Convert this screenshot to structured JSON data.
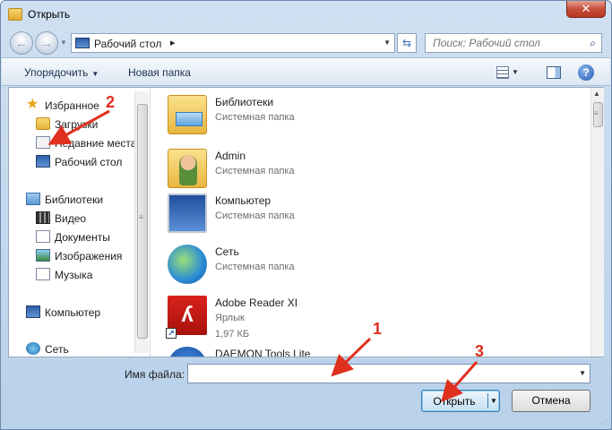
{
  "window": {
    "title": "Открыть",
    "close_label": "✕"
  },
  "address_bar": {
    "path": "Рабочий стол",
    "path_arrow": "▸",
    "search_placeholder": "Поиск: Рабочий стол"
  },
  "toolbar": {
    "organize_label": "Упорядочить",
    "new_folder_label": "Новая папка",
    "help_label": "?"
  },
  "nav_pane": {
    "items": [
      {
        "label": "Избранное",
        "icon": "star-icon"
      },
      {
        "label": "Загрузки",
        "icon": "downloads-folder-icon"
      },
      {
        "label": "Недавние места",
        "icon": "recent-places-icon"
      },
      {
        "label": "Рабочий стол",
        "icon": "desktop-icon"
      },
      {
        "label": "Библиотеки",
        "icon": "libraries-icon"
      },
      {
        "label": "Видео",
        "icon": "video-icon"
      },
      {
        "label": "Документы",
        "icon": "documents-icon"
      },
      {
        "label": "Изображения",
        "icon": "pictures-icon"
      },
      {
        "label": "Музыка",
        "icon": "music-icon"
      },
      {
        "label": "Компьютер",
        "icon": "computer-icon"
      },
      {
        "label": "Сеть",
        "icon": "network-icon"
      }
    ]
  },
  "files": [
    {
      "name": "Библиотеки",
      "type": "Системная папка",
      "icon": "libraries-folder-icon"
    },
    {
      "name": "Admin",
      "type": "Системная папка",
      "icon": "user-folder-icon"
    },
    {
      "name": "Компьютер",
      "type": "Системная папка",
      "icon": "computer-icon"
    },
    {
      "name": "Сеть",
      "type": "Системная папка",
      "icon": "network-icon"
    },
    {
      "name": "Adobe Reader XI",
      "type": "Ярлык",
      "size": "1,97 КБ",
      "icon": "pdf-shortcut-icon"
    },
    {
      "name": "DAEMON Tools Lite",
      "type": "",
      "icon": "daemon-tools-icon"
    }
  ],
  "bottom": {
    "filename_label": "Имя файла:",
    "filename_value": "",
    "open_label": "Открыть",
    "cancel_label": "Отмена"
  },
  "annotations": {
    "one": "1",
    "two": "2",
    "three": "3",
    "color": "#e0301e"
  }
}
